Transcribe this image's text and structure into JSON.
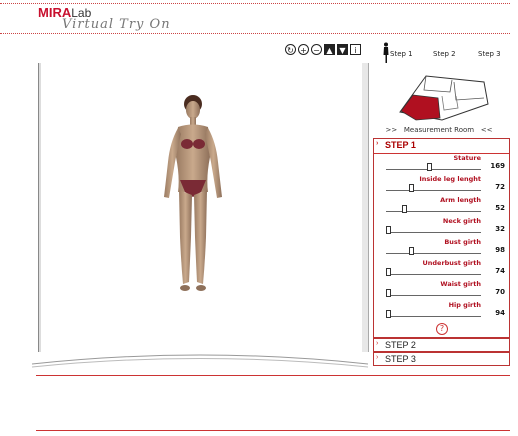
{
  "logo": {
    "brand": "MIRA",
    "lab": "Lab",
    "subtitle": "Virtual Try On"
  },
  "toolbar": {
    "icons": [
      "rotate-icon",
      "zoom-in-icon",
      "zoom-out-icon",
      "body-front-icon",
      "body-back-icon",
      "info-icon"
    ]
  },
  "steps_nav": {
    "step1": "Step 1",
    "step2": "Step 2",
    "step3": "Step 3"
  },
  "measurement_room": {
    "prev": ">>",
    "title": "Measurement Room",
    "next": "<<"
  },
  "panel": {
    "step1_label": "STEP 1",
    "step2_label": "STEP 2",
    "step3_label": "STEP 3",
    "measurements": [
      {
        "label": "Stature",
        "value": "169",
        "level": 0.45
      },
      {
        "label": "Inside leg lenght",
        "value": "72",
        "level": 0.25
      },
      {
        "label": "Arm length",
        "value": "52",
        "level": 0.18
      },
      {
        "label": "Neck girth",
        "value": "32",
        "level": 0.0
      },
      {
        "label": "Bust girth",
        "value": "98",
        "level": 0.25
      },
      {
        "label": "Underbust girth",
        "value": "74",
        "level": 0.0
      },
      {
        "label": "Waist girth",
        "value": "70",
        "level": 0.0
      },
      {
        "label": "Hip girth",
        "value": "94",
        "level": 0.0
      }
    ],
    "help": "?"
  }
}
